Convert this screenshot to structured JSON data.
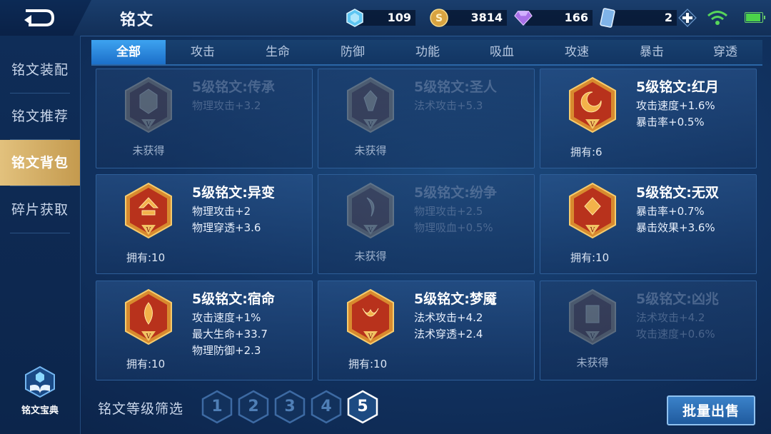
{
  "header": {
    "title": "铭文",
    "back_icon": "back-arrow-icon"
  },
  "resources": [
    {
      "name": "diamond",
      "icon": "diamond-icon",
      "value": "109"
    },
    {
      "name": "gold",
      "icon": "gold-coin-icon",
      "value": "3814"
    },
    {
      "name": "gem",
      "icon": "purple-gem-icon",
      "value": "166"
    },
    {
      "name": "card",
      "icon": "inscription-card-icon",
      "value": "2"
    }
  ],
  "status": {
    "battery_level": 0.9
  },
  "sidebar": {
    "items": [
      {
        "label": "铭文装配",
        "active": false
      },
      {
        "label": "铭文推荐",
        "active": false
      },
      {
        "label": "铭文背包",
        "active": true
      },
      {
        "label": "碎片获取",
        "active": false
      }
    ],
    "codex_label": "铭文宝典"
  },
  "tabs": [
    "全部",
    "攻击",
    "生命",
    "防御",
    "功能",
    "吸血",
    "攻速",
    "暴击",
    "穿透"
  ],
  "active_tab": "全部",
  "cards": [
    {
      "name": "5级铭文:传承",
      "stats": [
        "物理攻击+3.2"
      ],
      "owned": null,
      "status": "未获得",
      "level_mark": "V"
    },
    {
      "name": "5级铭文:圣人",
      "stats": [
        "法术攻击+5.3"
      ],
      "owned": null,
      "status": "未获得",
      "level_mark": "V"
    },
    {
      "name": "5级铭文:红月",
      "stats": [
        "攻击速度+1.6%",
        "暴击率+0.5%"
      ],
      "owned": "拥有:6",
      "status": "",
      "level_mark": "V"
    },
    {
      "name": "5级铭文:异变",
      "stats": [
        "物理攻击+2",
        "物理穿透+3.6"
      ],
      "owned": "拥有:10",
      "status": "",
      "level_mark": "V"
    },
    {
      "name": "5级铭文:纷争",
      "stats": [
        "物理攻击+2.5",
        "物理吸血+0.5%"
      ],
      "owned": null,
      "status": "未获得",
      "level_mark": "V"
    },
    {
      "name": "5级铭文:无双",
      "stats": [
        "暴击率+0.7%",
        "暴击效果+3.6%"
      ],
      "owned": "拥有:10",
      "status": "",
      "level_mark": "V"
    },
    {
      "name": "5级铭文:宿命",
      "stats": [
        "攻击速度+1%",
        "最大生命+33.7",
        "物理防御+2.3"
      ],
      "owned": "拥有:10",
      "status": "",
      "level_mark": "V"
    },
    {
      "name": "5级铭文:梦魇",
      "stats": [
        "法术攻击+4.2",
        "法术穿透+2.4"
      ],
      "owned": "拥有:10",
      "status": "",
      "level_mark": "V"
    },
    {
      "name": "5级铭文:凶兆",
      "stats": [
        "法术攻击+4.2",
        "攻击速度+0.6%"
      ],
      "owned": null,
      "status": "未获得",
      "level_mark": "V"
    }
  ],
  "footer": {
    "filter_label": "铭文等级筛选",
    "levels": [
      "1",
      "2",
      "3",
      "4",
      "5"
    ],
    "active_level": "5",
    "sell_button": "批量出售"
  }
}
